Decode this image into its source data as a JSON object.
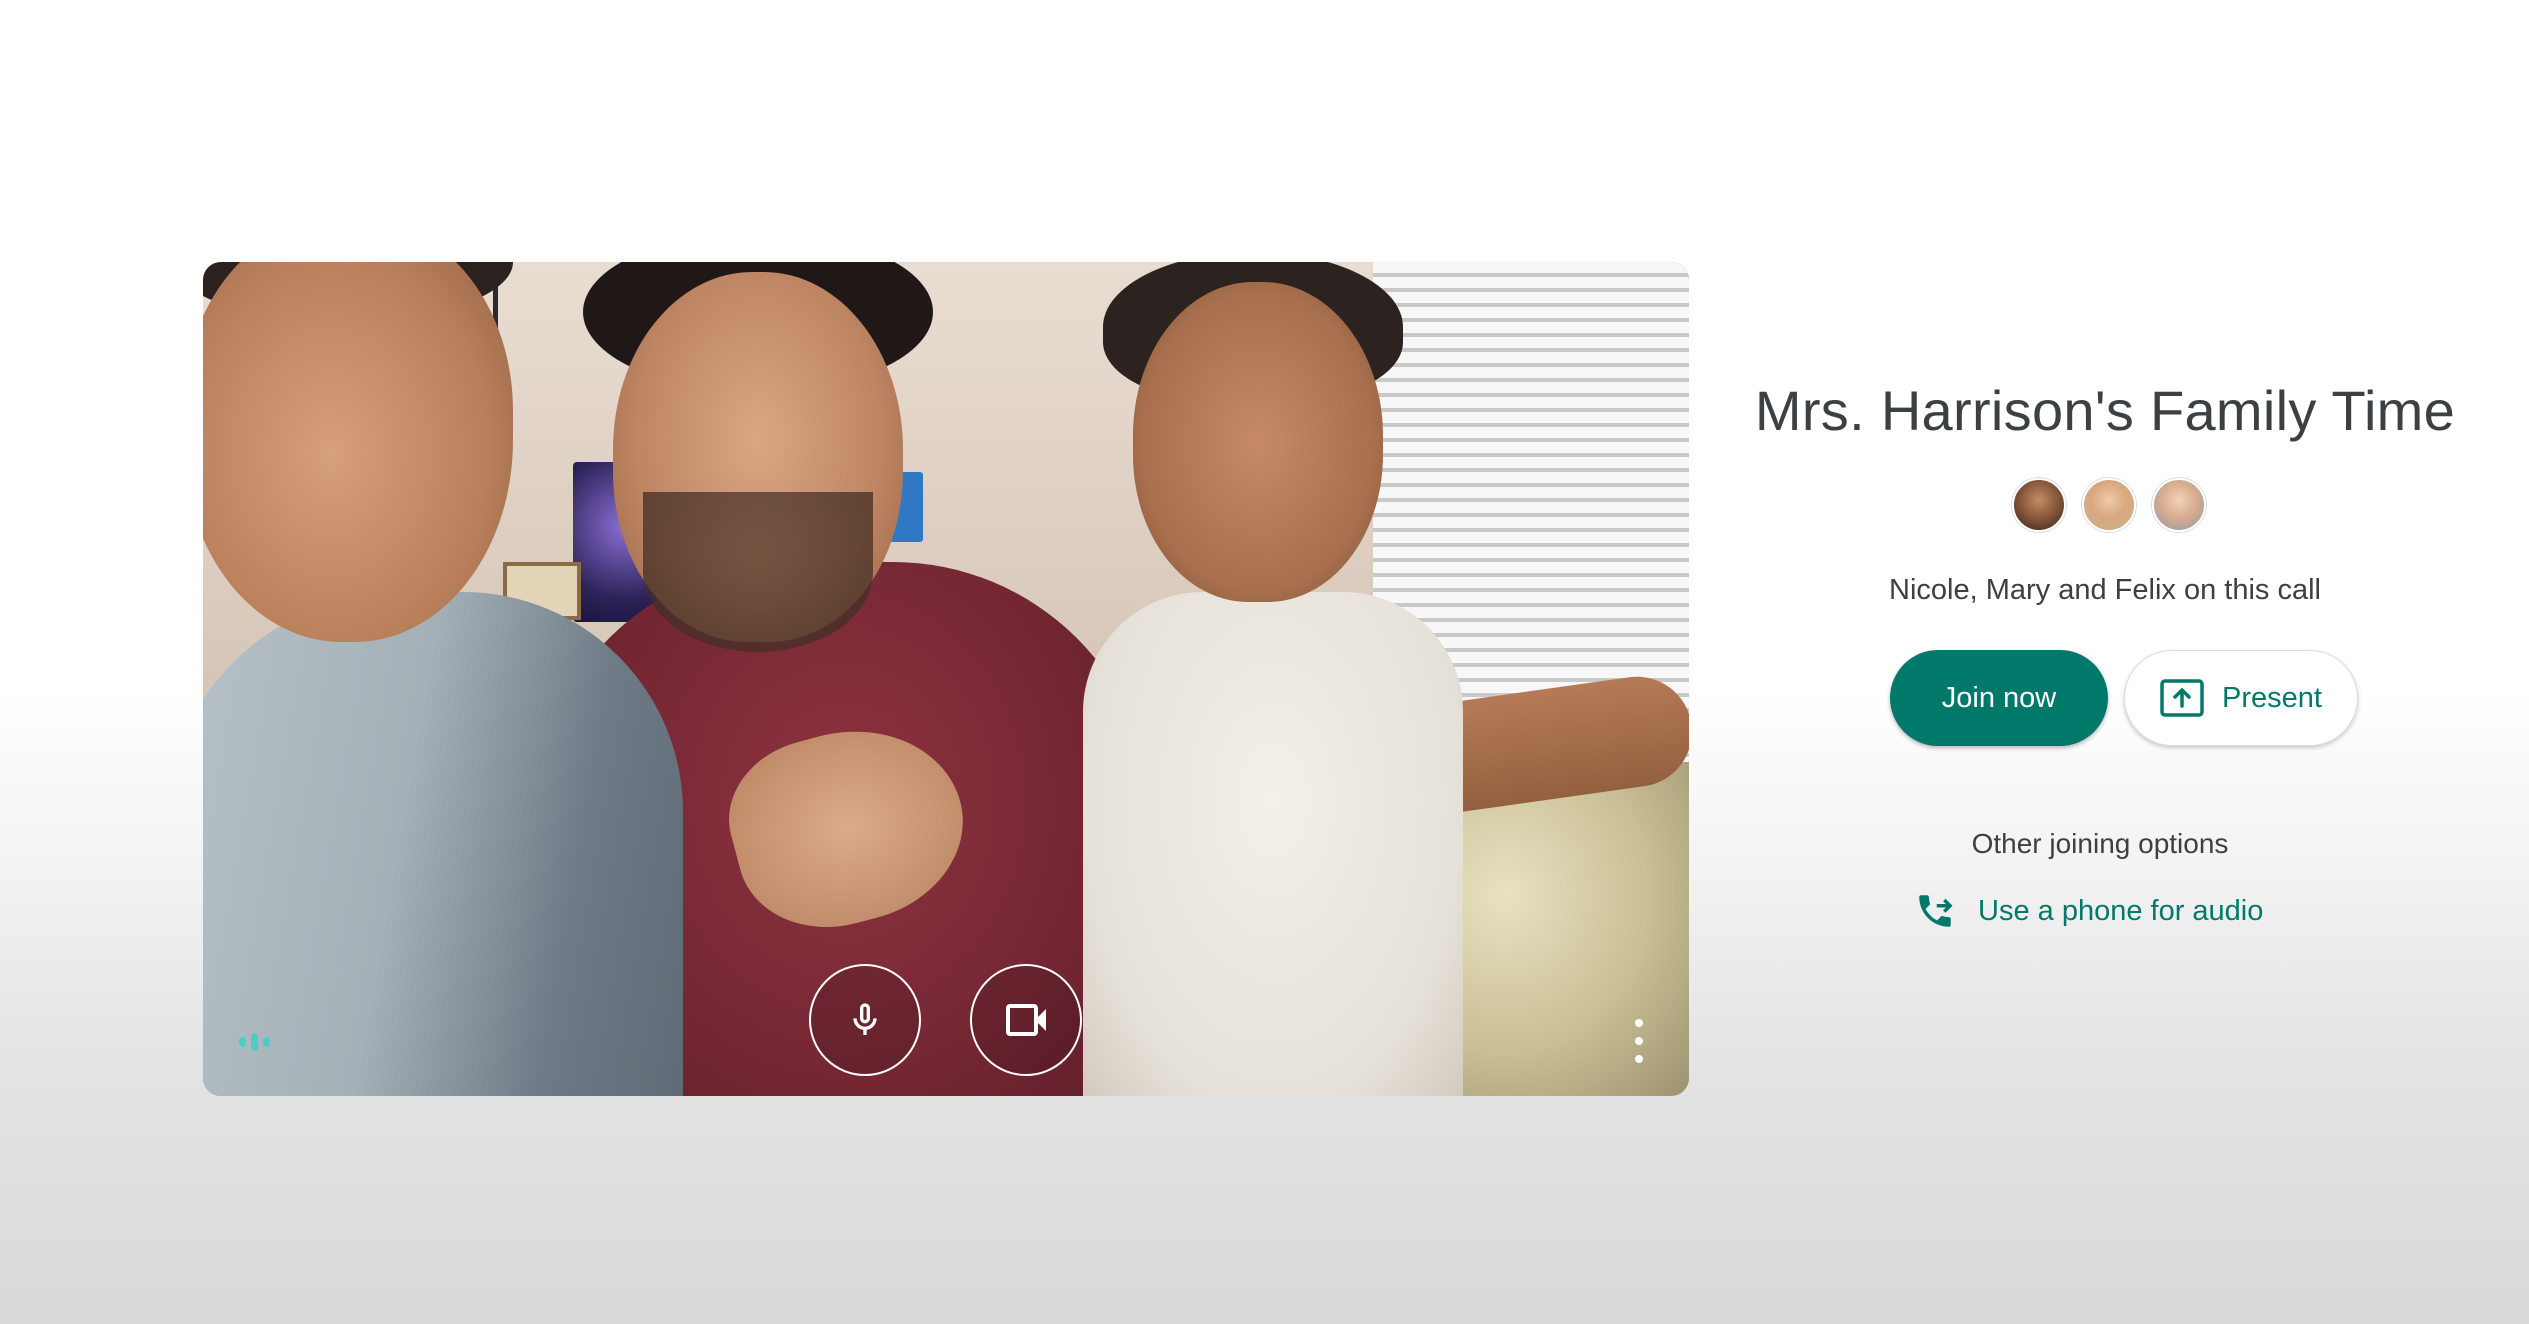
{
  "meeting": {
    "title": "Mrs. Harrison's Family Time",
    "participants_text": "Nicole, Mary and Felix on this call",
    "participants": [
      {
        "name": "Nicole"
      },
      {
        "name": "Mary"
      },
      {
        "name": "Felix"
      }
    ]
  },
  "actions": {
    "join_label": "Join now",
    "present_label": "Present",
    "other_options_label": "Other joining options",
    "phone_audio_label": "Use a phone for audio"
  },
  "preview": {
    "mic_icon": "microphone-icon",
    "camera_icon": "camera-icon",
    "more_icon": "more-vert-icon",
    "audio_indicator_icon": "audio-level-icon"
  },
  "colors": {
    "accent": "#00796b",
    "audio_indicator": "#4ecdc4",
    "title_text": "#3c4043"
  }
}
